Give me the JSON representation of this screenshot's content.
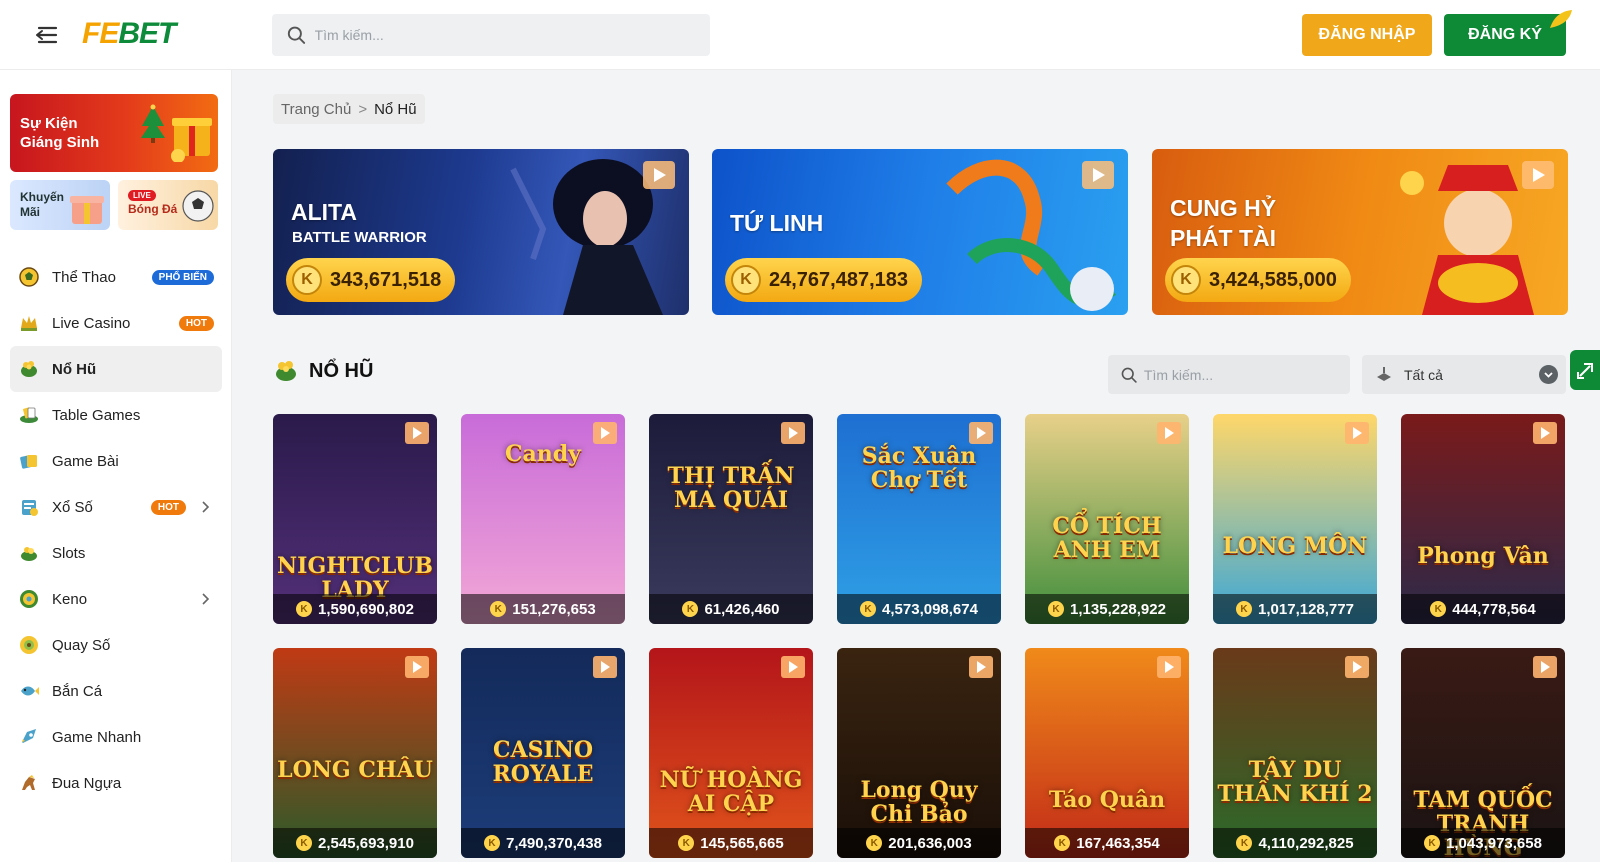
{
  "header": {
    "logo_left": "FE",
    "logo_right": "BET",
    "search_placeholder": "Tìm kiếm...",
    "login_label": "ĐĂNG NHẬP",
    "register_label": "ĐĂNG KÝ"
  },
  "sidebar": {
    "promo_xmas": "Sự Kiện Giáng Sinh",
    "promo_km": "Khuyến Mãi",
    "promo_live_tag": "LIVE",
    "promo_bd": "Bóng Đá",
    "items": [
      {
        "label": "Thể Thao",
        "badge": "PHỔ BIẾN",
        "icon": "football-icon"
      },
      {
        "label": "Live Casino",
        "badge": "HOT",
        "icon": "crown-icon"
      },
      {
        "label": "Nổ Hũ",
        "icon": "pot-icon"
      },
      {
        "label": "Table Games",
        "icon": "cards-icon"
      },
      {
        "label": "Game Bài",
        "icon": "playing-cards-icon"
      },
      {
        "label": "Xổ Số",
        "badge": "HOT",
        "icon": "lottery-icon"
      },
      {
        "label": "Slots",
        "icon": "slots-icon"
      },
      {
        "label": "Keno",
        "icon": "keno-icon"
      },
      {
        "label": "Quay Số",
        "icon": "wheel-icon"
      },
      {
        "label": "Bắn Cá",
        "icon": "fish-icon"
      },
      {
        "label": "Game Nhanh",
        "icon": "rocket-icon"
      },
      {
        "label": "Đua Ngựa",
        "icon": "horse-icon"
      }
    ]
  },
  "breadcrumb": {
    "home": "Trang Chủ",
    "sep": ">",
    "current": "Nổ Hũ"
  },
  "banners": [
    {
      "title": "ALITA",
      "subtitle": "BATTLE WARRIOR",
      "jackpot": "343,671,518"
    },
    {
      "title": "TỨ LINH",
      "subtitle": "",
      "jackpot": "24,767,487,183"
    },
    {
      "title": "CUNG HỶ PHÁT TÀI",
      "subtitle": "",
      "jackpot": "3,424,585,000"
    }
  ],
  "coin_symbol": "K",
  "section": {
    "title": "NỔ HŨ",
    "search_placeholder": "Tìm kiếm...",
    "filter_value": "Tất cả"
  },
  "games": [
    {
      "title": "NIGHTCLUB LADY",
      "jackpot": "1,590,690,802"
    },
    {
      "title": "Candy",
      "jackpot": "151,276,653"
    },
    {
      "title": "THỊ TRẤN MA QUÁI",
      "jackpot": "61,426,460"
    },
    {
      "title": "Sắc Xuân Chợ Tết",
      "jackpot": "4,573,098,674"
    },
    {
      "title": "CỔ TÍCH ANH EM",
      "jackpot": "1,135,228,922"
    },
    {
      "title": "LONG MÔN",
      "jackpot": "1,017,128,777"
    },
    {
      "title": "Phong Vân",
      "jackpot": "444,778,564"
    },
    {
      "title": "LONG CHÂU",
      "jackpot": "2,545,693,910"
    },
    {
      "title": "CASINO ROYALE",
      "jackpot": "7,490,370,438"
    },
    {
      "title": "NỮ HOÀNG AI CẬP",
      "jackpot": "145,565,665"
    },
    {
      "title": "Long Quy Chi Bảo",
      "jackpot": "201,636,003"
    },
    {
      "title": "Táo Quân",
      "jackpot": "167,463,354"
    },
    {
      "title": "TÂY DU THẦN KHÍ 2",
      "jackpot": "4,110,292,825"
    },
    {
      "title": "TAM QUỐC TRANH HÙNG",
      "jackpot": "1,043,973,658"
    }
  ]
}
